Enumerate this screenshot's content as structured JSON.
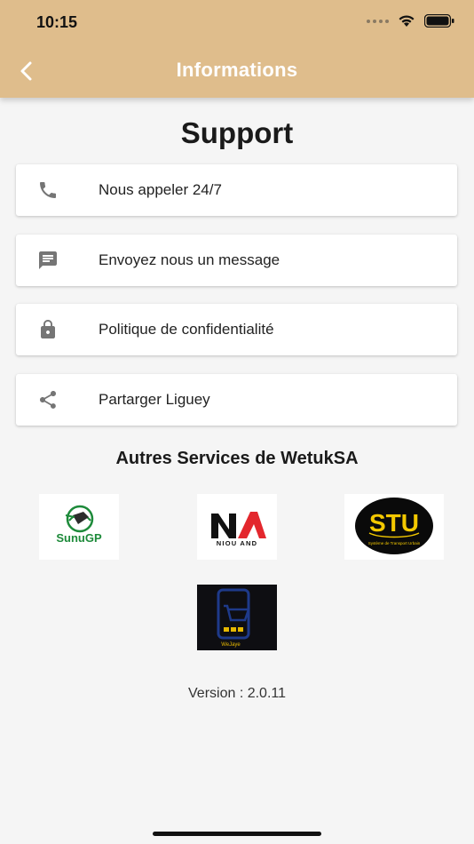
{
  "status_bar": {
    "time": "10:15"
  },
  "header": {
    "title": "Informations",
    "back_icon": "chevron-left-icon"
  },
  "support": {
    "heading": "Support",
    "items": [
      {
        "label": "Nous appeler 24/7",
        "icon": "phone-icon"
      },
      {
        "label": "Envoyez nous un message",
        "icon": "message-icon"
      },
      {
        "label": "Politique de confidentialité",
        "icon": "lock-icon"
      },
      {
        "label": "Partarger Liguey",
        "icon": "share-icon"
      }
    ]
  },
  "services": {
    "title": "Autres Services de WetukSA",
    "logos": [
      {
        "name": "SunuGP",
        "text": "SunuGP"
      },
      {
        "name": "Niou And",
        "text": "NIOU AND"
      },
      {
        "name": "STU",
        "text": "STU",
        "subtext": "Système de Transport Urbain"
      },
      {
        "name": "WeJaye",
        "text": "WeJaye"
      }
    ]
  },
  "footer": {
    "version": "Version : 2.0.11"
  },
  "colors": {
    "header": "#dfbd8c",
    "background": "#f5f5f5",
    "icon": "#757575"
  }
}
